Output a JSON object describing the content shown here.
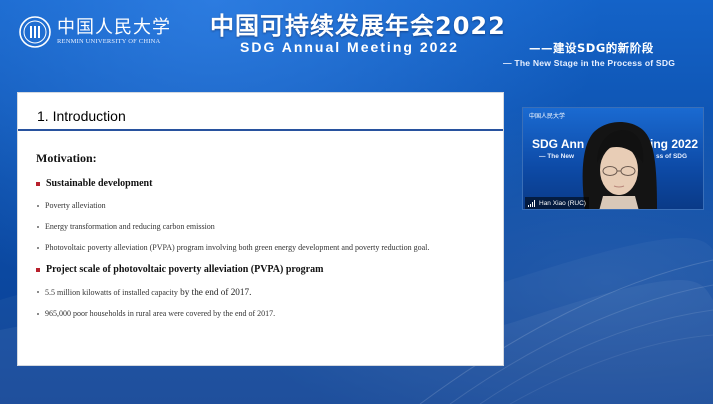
{
  "header": {
    "logo_cn": "中国人民大学",
    "logo_en": "RENMIN UNIVERSITY OF CHINA",
    "title_cn": "中国可持续发展年会2022",
    "title_en": "SDG Annual Meeting 2022",
    "subtitle_cn": "——建设SDG的新阶段",
    "subtitle_en": "— The New Stage in the Process of SDG"
  },
  "slide": {
    "title": "1. Introduction",
    "motivation": "Motivation:",
    "sections": [
      {
        "heading": "Sustainable development",
        "items": [
          "Poverty alleviation",
          "Energy transformation and reducing carbon emission",
          "Photovoltaic poverty alleviation (PVPA) program involving both green energy development and poverty reduction goal."
        ]
      },
      {
        "heading": "Project scale of photovoltaic poverty alleviation (PVPA) program",
        "items": [
          {
            "a": "5.5 million kilowatts of installed capacity",
            "b": " by the end of 2017."
          },
          "965,000 poor households in rural area were covered by the end of 2017."
        ]
      }
    ]
  },
  "video": {
    "logo_cn": "中国人民大学",
    "title_left": "SDG Ann",
    "title_right": "ing 2022",
    "sub_left": "— The New",
    "sub_right": "ss of SDG",
    "participant_name": "Han Xiao (RUC)"
  },
  "colors": {
    "background": "#0d4fb1",
    "slide_rule": "#28529e",
    "bullet_red": "#b8202c"
  }
}
